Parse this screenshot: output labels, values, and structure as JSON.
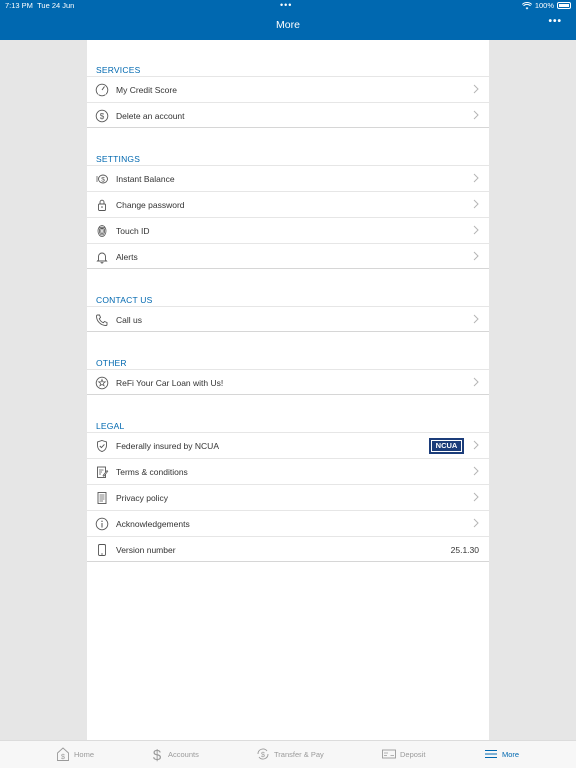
{
  "status_bar": {
    "time": "7:13 PM",
    "date": "Tue 24 Jun",
    "battery": "100%"
  },
  "header": {
    "title": "More",
    "more_icon": "ellipsis-icon"
  },
  "sections": {
    "services": {
      "label": "SERVICES",
      "items": [
        {
          "label": "My Credit Score",
          "icon": "gauge-icon"
        },
        {
          "label": "Delete an account",
          "icon": "dollar-circle-icon"
        }
      ]
    },
    "settings": {
      "label": "SETTINGS",
      "items": [
        {
          "label": "Instant Balance",
          "icon": "cash-icon"
        },
        {
          "label": "Change password",
          "icon": "lock-icon"
        },
        {
          "label": "Touch ID",
          "icon": "fingerprint-icon"
        },
        {
          "label": "Alerts",
          "icon": "bell-icon"
        }
      ]
    },
    "contact": {
      "label": "CONTACT US",
      "items": [
        {
          "label": "Call us",
          "icon": "phone-icon"
        }
      ]
    },
    "other": {
      "label": "OTHER",
      "items": [
        {
          "label": "ReFi Your Car Loan with Us!",
          "icon": "star-circle-icon"
        }
      ]
    },
    "legal": {
      "label": "LEGAL",
      "items": [
        {
          "label": "Federally insured by NCUA",
          "icon": "shield-check-icon",
          "badge": "NCUA"
        },
        {
          "label": "Terms & conditions",
          "icon": "document-edit-icon"
        },
        {
          "label": "Privacy policy",
          "icon": "document-icon"
        },
        {
          "label": "Acknowledgements",
          "icon": "info-icon"
        },
        {
          "label": "Version number",
          "icon": "phone-device-icon",
          "value": "25.1.30"
        }
      ]
    }
  },
  "tabbar": {
    "tabs": [
      {
        "label": "Home",
        "icon": "home-dollar-icon",
        "active": false
      },
      {
        "label": "Accounts",
        "icon": "dollar-icon",
        "active": false
      },
      {
        "label": "Transfer & Pay",
        "icon": "transfer-icon",
        "active": false
      },
      {
        "label": "Deposit",
        "icon": "check-deposit-icon",
        "active": false
      },
      {
        "label": "More",
        "icon": "menu-icon",
        "active": true
      }
    ]
  },
  "colors": {
    "brand": "#0068b0",
    "background": "#e6e6e6",
    "ncua_badge": "#1c3d7a"
  }
}
